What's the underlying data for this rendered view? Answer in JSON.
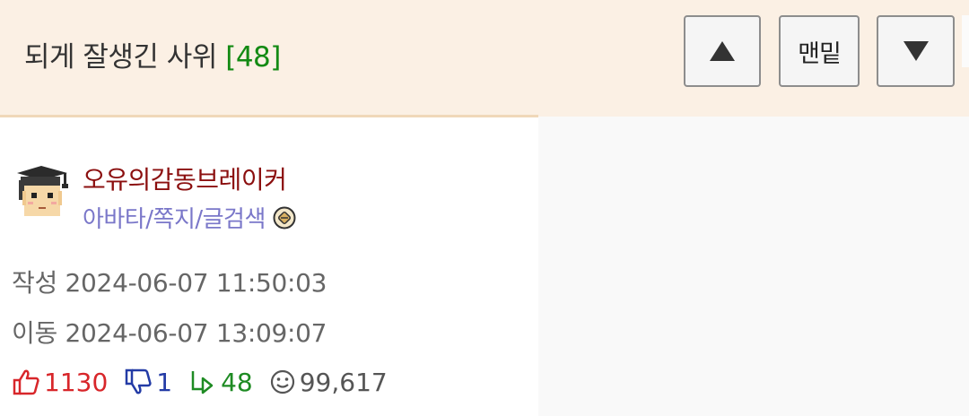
{
  "post": {
    "title": "되게 잘생긴 사위",
    "comment_count": "[48]"
  },
  "nav": {
    "bottom_label": "맨밑",
    "up_icon": "triangle-up-icon",
    "down_icon": "triangle-down-icon"
  },
  "author": {
    "name": "오유의감동브레이커",
    "links": "아바타/쪽지/글검색",
    "avatar_icon": "graduation-cap-avatar",
    "level_icon": "level-badge-icon"
  },
  "meta": {
    "created": "작성 2024-06-07 11:50:03",
    "moved": "이동 2024-06-07 13:09:07"
  },
  "stats": {
    "upvotes": "1130",
    "downvotes": "1",
    "replies": "48",
    "views": "99,617"
  },
  "colors": {
    "header_bg": "#fbf0e4",
    "count_green": "#138a13",
    "author_red": "#8b0f0f",
    "link_purple": "#7a77c9",
    "up_red": "#d8262a",
    "down_blue": "#233ba6"
  }
}
